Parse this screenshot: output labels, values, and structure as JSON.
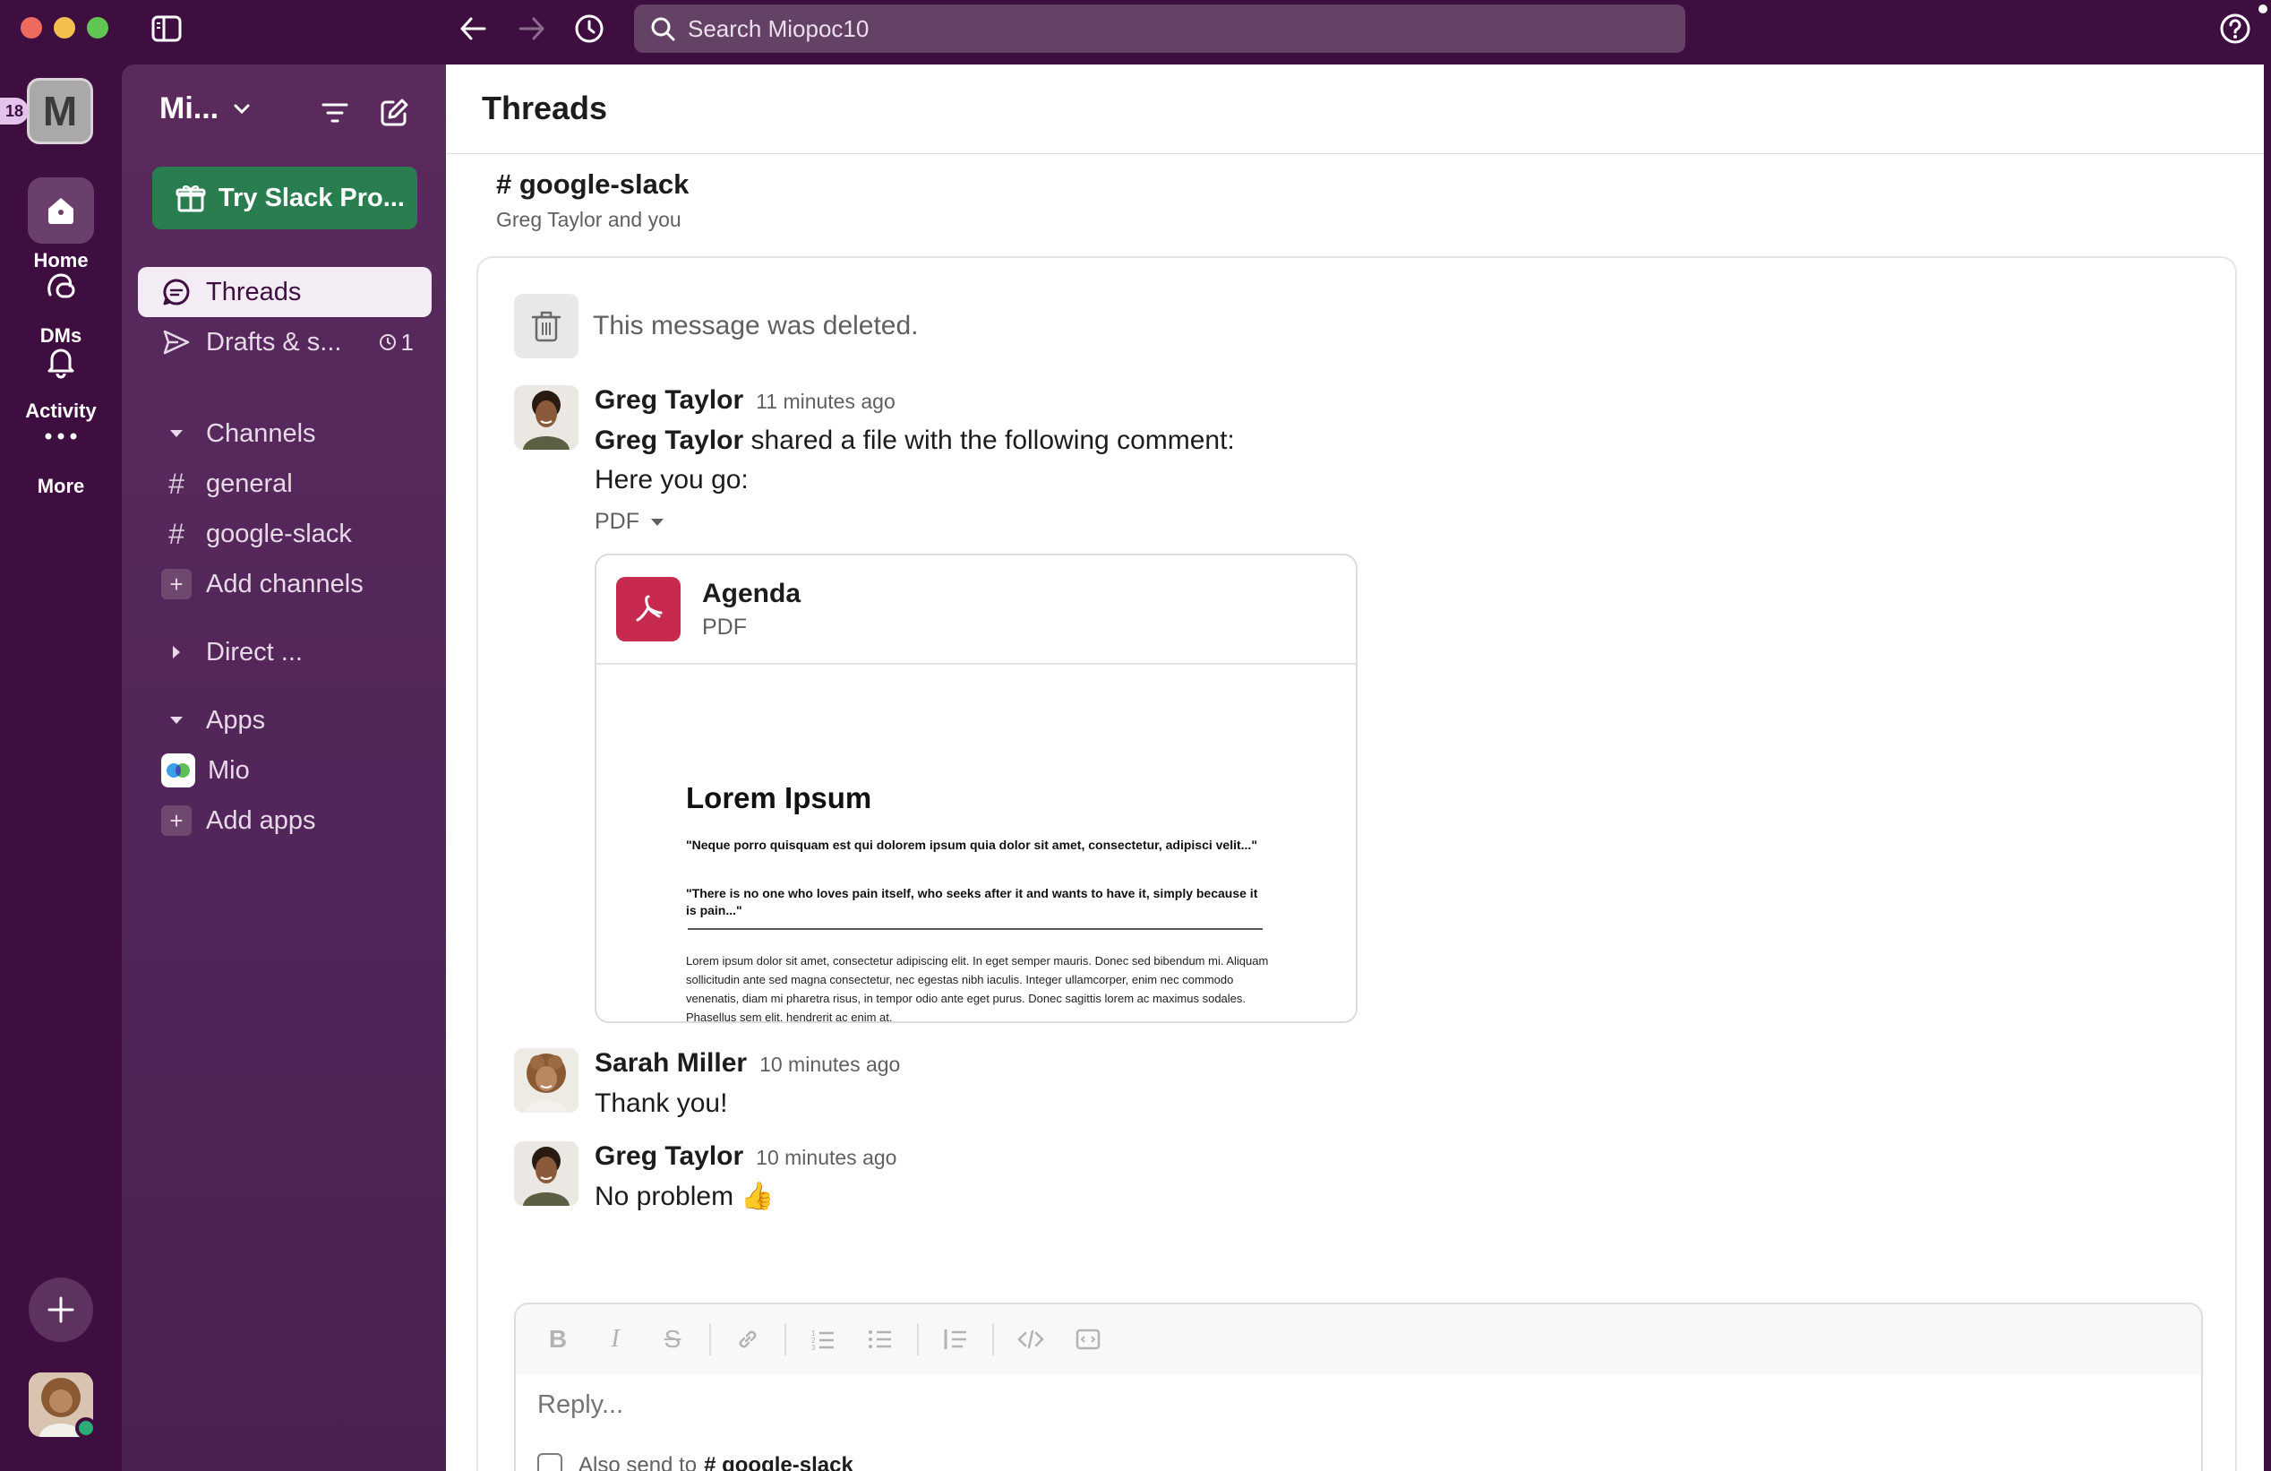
{
  "titlebar": {
    "search_placeholder": "Search Miopoc10"
  },
  "rail": {
    "workspace_initial": "M",
    "unread_count": "18",
    "items": [
      {
        "label": "Home",
        "icon": "home-icon"
      },
      {
        "label": "DMs",
        "icon": "dms-icon"
      },
      {
        "label": "Activity",
        "icon": "bell-icon"
      },
      {
        "label": "More",
        "icon": "more-icon"
      }
    ]
  },
  "sidebar": {
    "workspace_name": "Mi...",
    "try_pro_label": "Try Slack Pro...",
    "nav": [
      {
        "label": "Threads",
        "active": true
      },
      {
        "label": "Drafts & s...",
        "badge": "1"
      }
    ],
    "channels_header": "Channels",
    "channels": [
      "general",
      "google-slack"
    ],
    "add_channels_label": "Add channels",
    "direct_header": "Direct ...",
    "apps_header": "Apps",
    "apps": [
      "Mio"
    ],
    "add_apps_label": "Add apps"
  },
  "main": {
    "title": "Threads",
    "channel_name": "# google-slack",
    "channel_sub": "Greg Taylor and you",
    "deleted_text": "This message was deleted.",
    "messages": [
      {
        "author": "Greg Taylor",
        "time": "11 minutes ago",
        "line1_author": "Greg Taylor",
        "line1_rest": " shared a file with the following comment:",
        "line2": "Here you go:",
        "file_toggle": "PDF"
      },
      {
        "author": "Sarah Miller",
        "time": "10 minutes ago",
        "text": "Thank you!"
      },
      {
        "author": "Greg Taylor",
        "time": "10 minutes ago",
        "text": "No problem 👍"
      }
    ],
    "file": {
      "name": "Agenda",
      "type": "PDF",
      "preview_title": "Lorem Ipsum",
      "preview_quote1": "\"Neque porro quisquam est qui dolorem ipsum quia dolor sit amet, consectetur, adipisci velit...\"",
      "preview_quote2": "\"There is no one who loves pain itself, who seeks after it and wants to have it, simply because it is pain...\"",
      "preview_para": "Lorem ipsum dolor sit amet, consectetur adipiscing elit. In eget semper mauris. Donec sed bibendum mi. Aliquam sollicitudin ante sed magna consectetur, nec egestas nibh iaculis. Integer ullamcorper, enim nec commodo venenatis, diam mi pharetra risus, in tempor odio ante eget purus. Donec sagittis lorem ac maximus sodales. Phasellus sem elit, hendrerit ac enim at,"
    },
    "composer": {
      "placeholder": "Reply...",
      "also_send_label": "Also send to",
      "also_send_channel": "# google-slack"
    }
  }
}
